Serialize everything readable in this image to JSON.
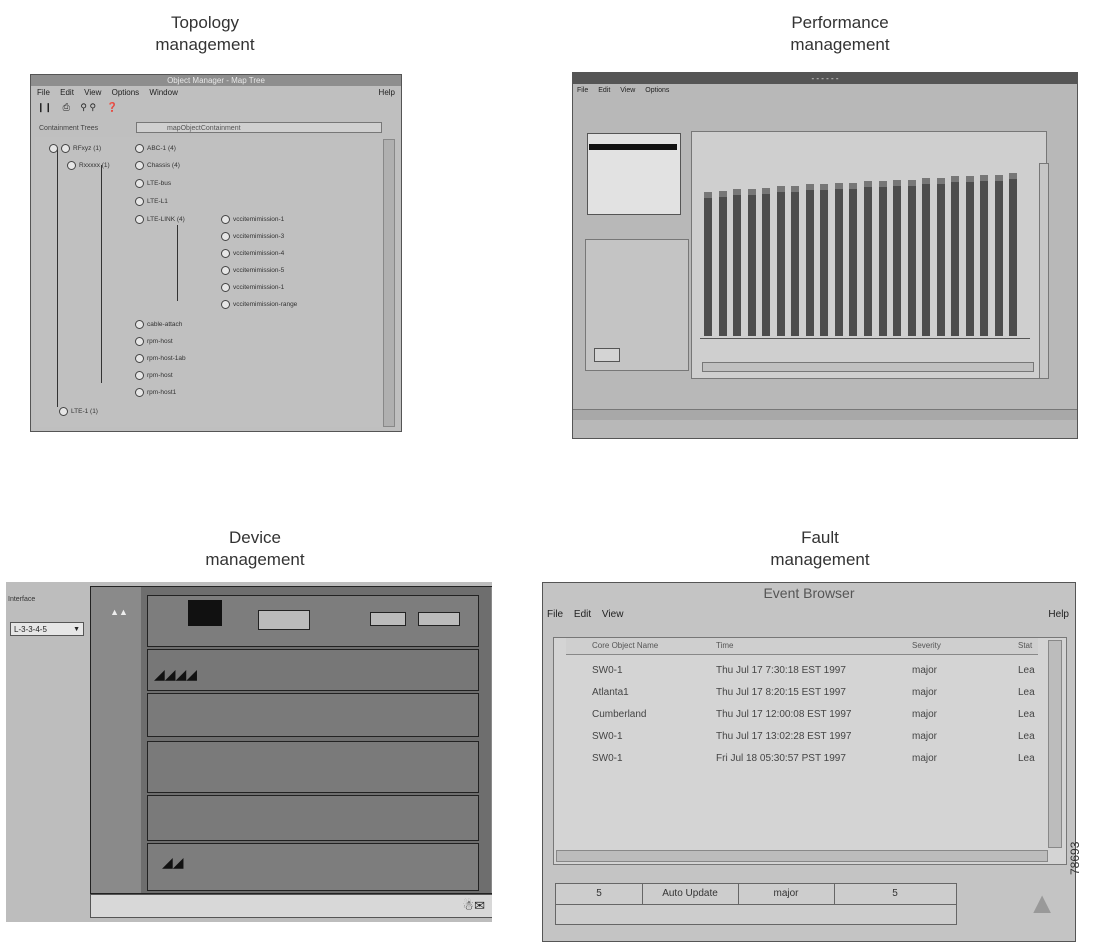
{
  "captions": {
    "topology": [
      "Topology",
      "management"
    ],
    "performance": [
      "Performance",
      "management"
    ],
    "device": [
      "Device",
      "management"
    ],
    "fault": [
      "Fault",
      "management"
    ]
  },
  "topology": {
    "window_title": "Object Manager - Map Tree",
    "menu": [
      "File",
      "Edit",
      "View",
      "Options",
      "Window"
    ],
    "help": "Help",
    "containment_label": "Containment Trees",
    "containment_value": "mapObjectContainment",
    "nodes": [
      "RFxyz (1)",
      "Rxxxxx (1)",
      "Chassis (4)",
      "ABC-1 (4)",
      "LTE-bus",
      "LTE-L1",
      "LTE-LINK (4)",
      "vccitemimission-1",
      "vccitemimission-3",
      "vccitemimission-4",
      "vccitemimission-5",
      "vccitemimission-1",
      "vccitemimission-range",
      "cable-attach",
      "rpm-host",
      "rpm-host-1ab",
      "rpm-host",
      "rpm-host1",
      "LTE-1 (1)"
    ]
  },
  "performance": {
    "window_title": "- - - - - -",
    "menu": [
      "File",
      "Edit",
      "View",
      "Options"
    ],
    "bar_values": [
      0.86,
      0.87,
      0.88,
      0.88,
      0.89,
      0.9,
      0.9,
      0.91,
      0.91,
      0.92,
      0.92,
      0.93,
      0.93,
      0.94,
      0.94,
      0.95,
      0.95,
      0.96,
      0.96,
      0.97,
      0.97,
      0.98
    ]
  },
  "device": {
    "interface_label": "Interface",
    "interface_value": "L-3-3-4-5"
  },
  "fault": {
    "window_title": "Event Browser",
    "menu": [
      "File",
      "Edit",
      "View"
    ],
    "help": "Help",
    "columns": [
      "Core Object Name",
      "Time",
      "Severity",
      "Stat"
    ],
    "rows": [
      [
        "SW0-1",
        "Thu Jul 17  7:30:18 EST  1997",
        "major",
        "Lea"
      ],
      [
        "Atlanta1",
        "Thu Jul 17  8:20:15 EST  1997",
        "major",
        "Lea"
      ],
      [
        "Cumberland",
        "Thu Jul 17 12:00:08 EST  1997",
        "major",
        "Lea"
      ],
      [
        "SW0-1",
        "Thu Jul 17  13:02:28 EST  1997",
        "major",
        "Lea"
      ],
      [
        "SW0-1",
        "Fri Jul 18  05:30:57 PST  1997",
        "major",
        "Lea"
      ]
    ],
    "status": {
      "count1": "5",
      "auto_update": "Auto Update",
      "severity": "major",
      "count2": "5"
    }
  },
  "figure_id": "78693"
}
